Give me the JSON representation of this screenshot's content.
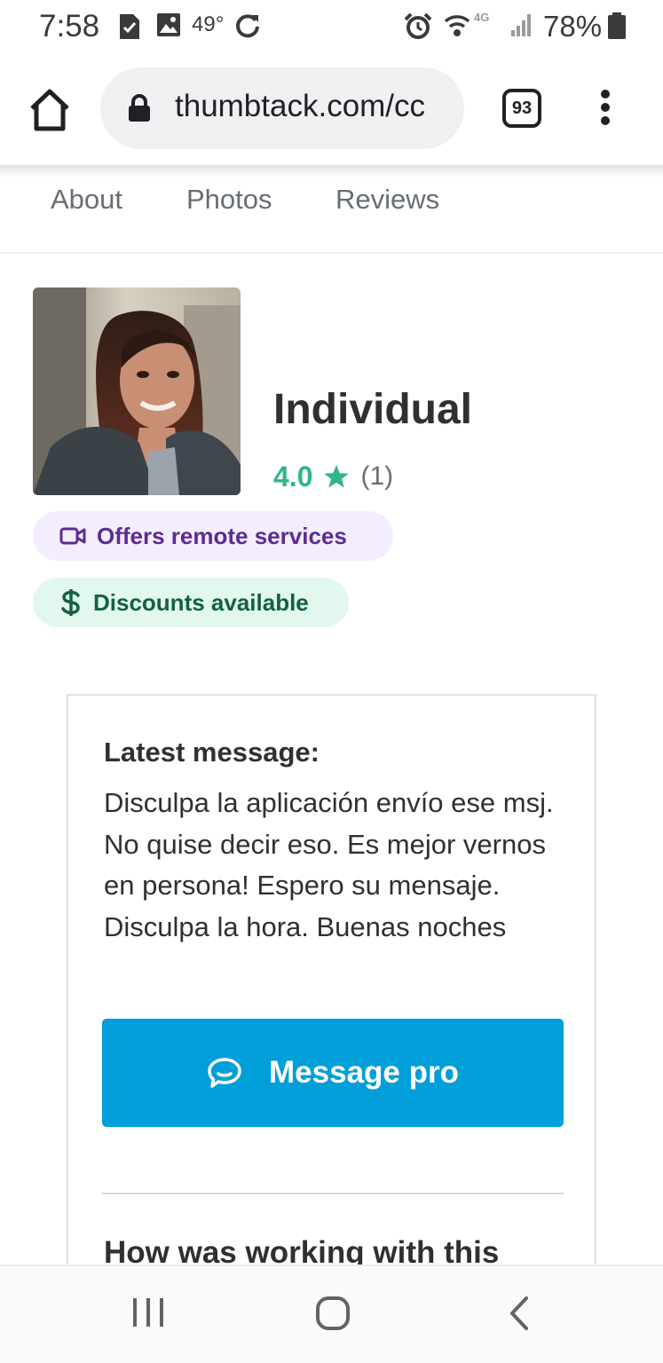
{
  "status_bar": {
    "time": "7:58",
    "temperature": "49°",
    "network": "4G",
    "battery": "78%",
    "icons": [
      "task-icon",
      "gallery-icon",
      "sync-icon",
      "alarm-icon",
      "wifi-icon",
      "signal-icon",
      "battery-icon"
    ]
  },
  "browser": {
    "url": "thumbtack.com/cc",
    "tab_count": "93"
  },
  "section_tabs": [
    "About",
    "Photos",
    "Reviews"
  ],
  "profile": {
    "name": "Individual",
    "rating": "4.0",
    "review_count": "(1)",
    "badges": {
      "remote": "Offers remote services",
      "discount": "Discounts available"
    }
  },
  "message_card": {
    "latest_label": "Latest message:",
    "latest_body": "Disculpa la aplicación envío ese msj. No quise decir eso. Es mejor vernos en persona! Espero su mensaje. Disculpa la hora. Buenas noches",
    "button_label": "Message pro",
    "review_prompt": "How was working with this"
  },
  "colors": {
    "accent": "#009fd9",
    "rating_green": "#2db783",
    "remote_badge_bg": "#f3edfd",
    "remote_badge_text": "#5b2c91",
    "discount_badge_bg": "#e2f8ef",
    "discount_badge_text": "#12623e"
  }
}
